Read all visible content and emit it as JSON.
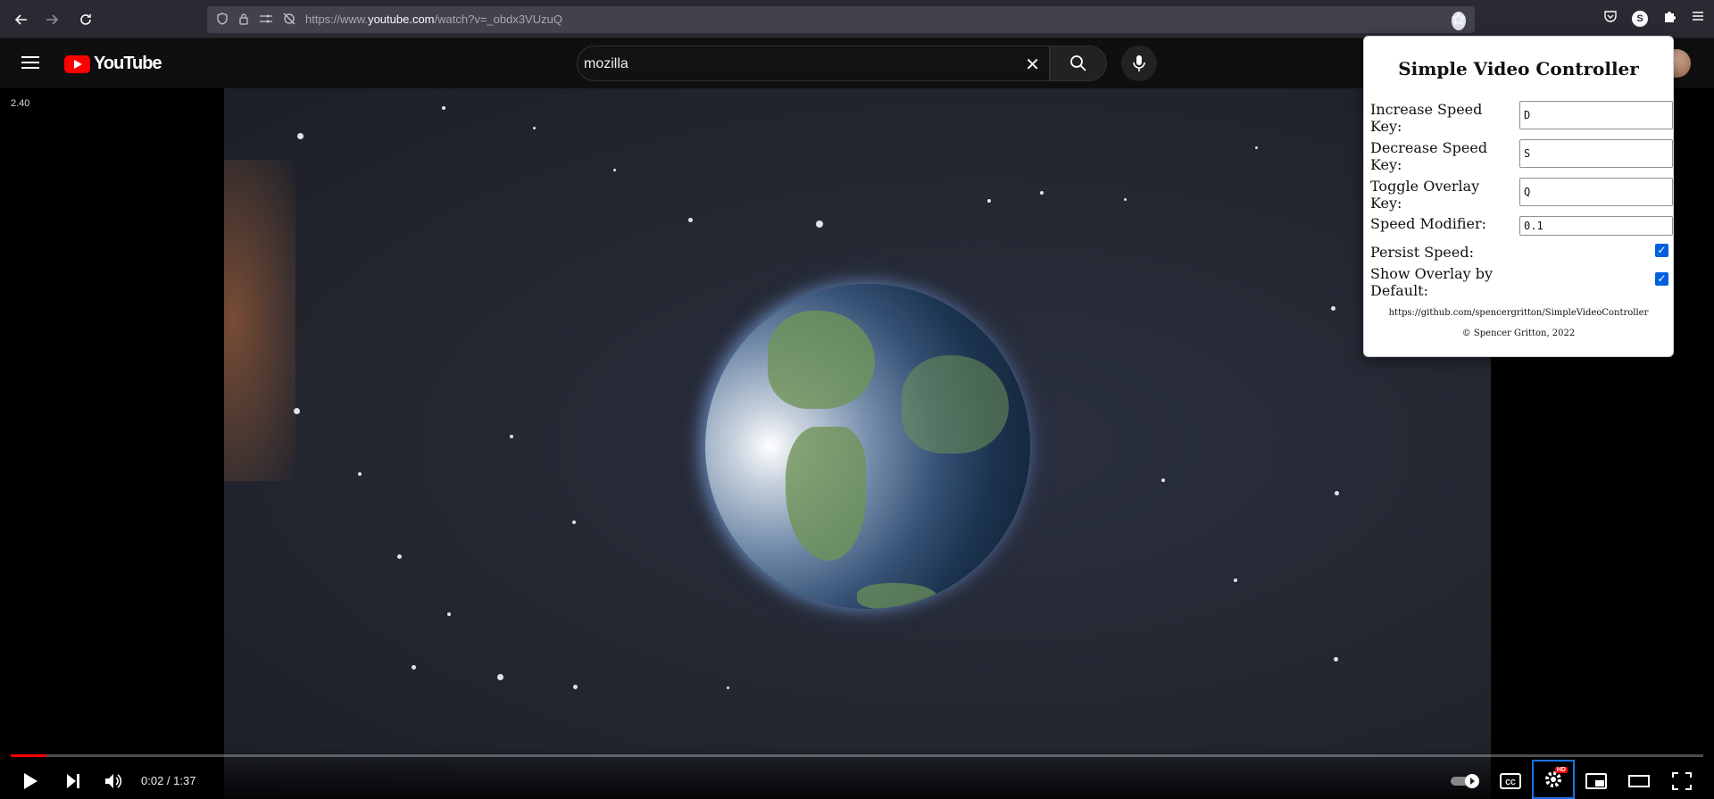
{
  "browser": {
    "url_prefix": "https://www.",
    "url_domain": "youtube.com",
    "url_path": "/watch?v=_obdx3VUzuQ",
    "profile_initial": "S"
  },
  "youtube": {
    "logo_text": "YouTube",
    "search_value": "mozilla"
  },
  "player": {
    "speed_overlay": "2.40",
    "current_time": "0:02",
    "duration": "1:37",
    "time_display": "0:02 / 1:37",
    "progress_fraction": 0.021,
    "hd_badge": "HD"
  },
  "popup": {
    "title": "Simple Video Controller",
    "increase_label": "Increase Speed Key:",
    "increase_value": "D",
    "decrease_label": "Decrease Speed Key:",
    "decrease_value": "S",
    "toggle_label": "Toggle Overlay Key:",
    "toggle_value": "Q",
    "modifier_label": "Speed Modifier:",
    "modifier_value": "0.1",
    "persist_label": "Persist Speed:",
    "persist_checked": true,
    "show_overlay_label": "Show Overlay by Default:",
    "show_overlay_checked": true,
    "link": "https://github.com/spencergritton/SimpleVideoController",
    "copyright": "© Spencer Gritton, 2022"
  },
  "colors": {
    "progress_played": "#ff0000",
    "checkbox": "#0060df",
    "focus_outline": "#1a73e8"
  }
}
